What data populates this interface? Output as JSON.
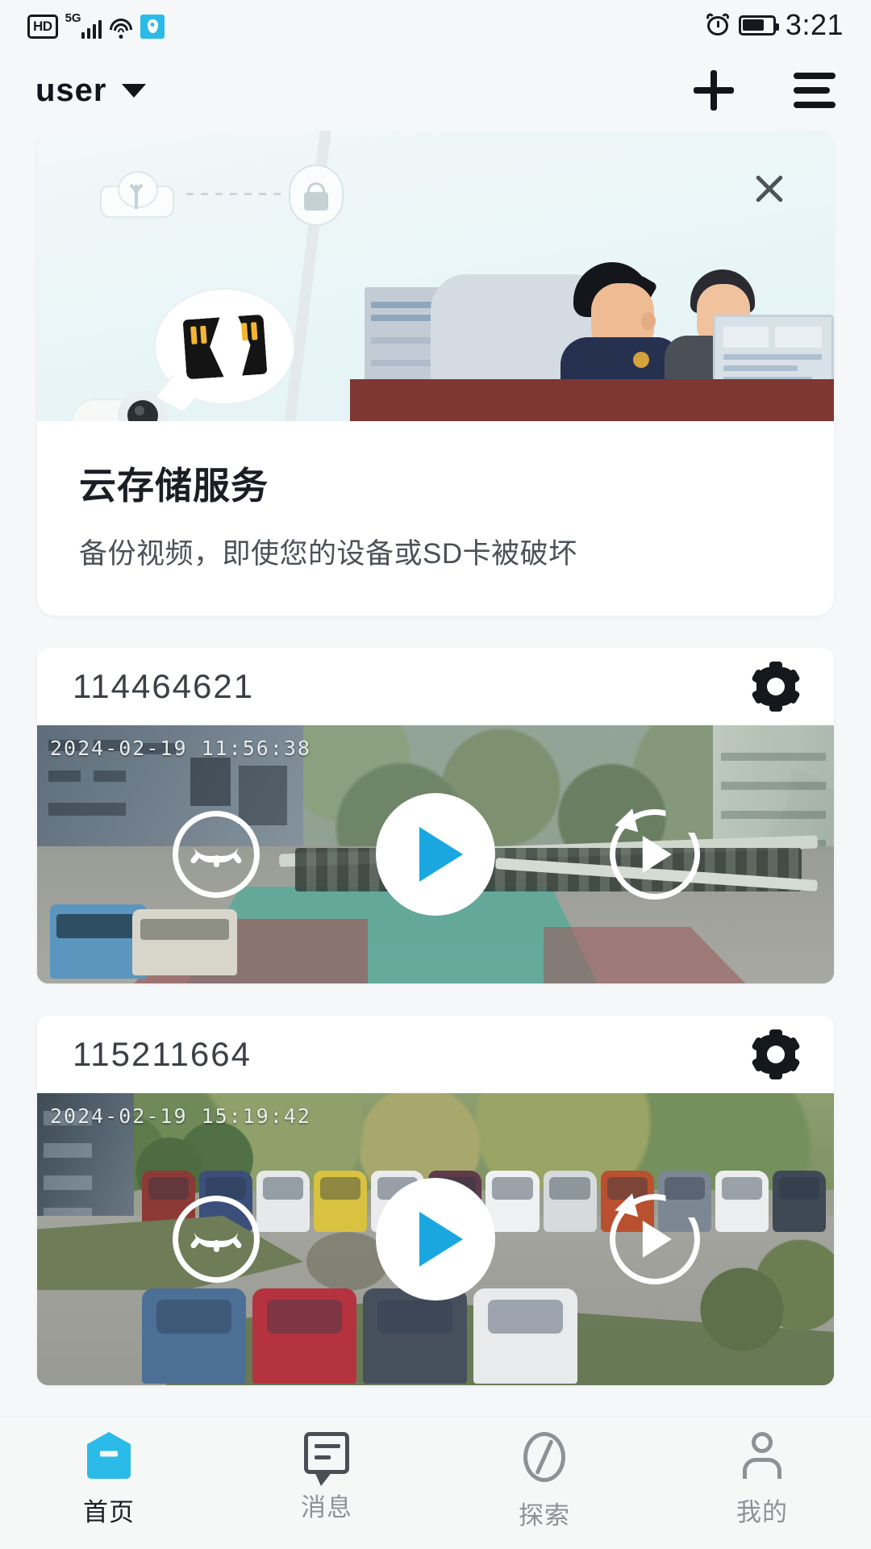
{
  "status_bar": {
    "hd_label": "HD",
    "network_label": "5G",
    "time": "3:21",
    "icons": [
      "hd-icon",
      "signal-bars-icon",
      "wifi-icon",
      "location-badge-icon",
      "alarm-clock-icon",
      "battery-icon"
    ]
  },
  "app_header": {
    "user_name": "user",
    "caret_icon": "chevron-down-icon",
    "add_icon": "plus-icon",
    "menu_icon": "hamburger-menu-icon"
  },
  "promo": {
    "close_icon": "close-icon",
    "title": "云存储服务",
    "subtitle": "备份视频，即使您的设备或SD卡被破坏",
    "illustration_icons": [
      "cloud-upload-icon",
      "lock-icon",
      "broken-sd-card-icon",
      "security-camera-icon"
    ]
  },
  "devices": [
    {
      "id": "114464621",
      "settings_icon": "gear-icon",
      "timestamp": "2024-02-19 11:56:38",
      "controls": {
        "privacy_icon": "closed-eye-icon",
        "play_icon": "play-icon",
        "playback_icon": "replay-playback-icon"
      }
    },
    {
      "id": "115211664",
      "settings_icon": "gear-icon",
      "timestamp": "2024-02-19 15:19:42",
      "controls": {
        "privacy_icon": "closed-eye-icon",
        "play_icon": "play-icon",
        "playback_icon": "replay-playback-icon"
      }
    }
  ],
  "tabbar": {
    "items": [
      {
        "label": "首页",
        "icon": "home-icon",
        "active": true
      },
      {
        "label": "消息",
        "icon": "message-icon",
        "active": false
      },
      {
        "label": "探索",
        "icon": "compass-icon",
        "active": false
      },
      {
        "label": "我的",
        "icon": "person-icon",
        "active": false
      }
    ]
  },
  "colors": {
    "accent": "#2cbbe8",
    "play_blue": "#1aa7e0",
    "text_primary": "#1b1e24",
    "text_secondary": "#8d9296",
    "page_bg": "#f5f7f8"
  }
}
